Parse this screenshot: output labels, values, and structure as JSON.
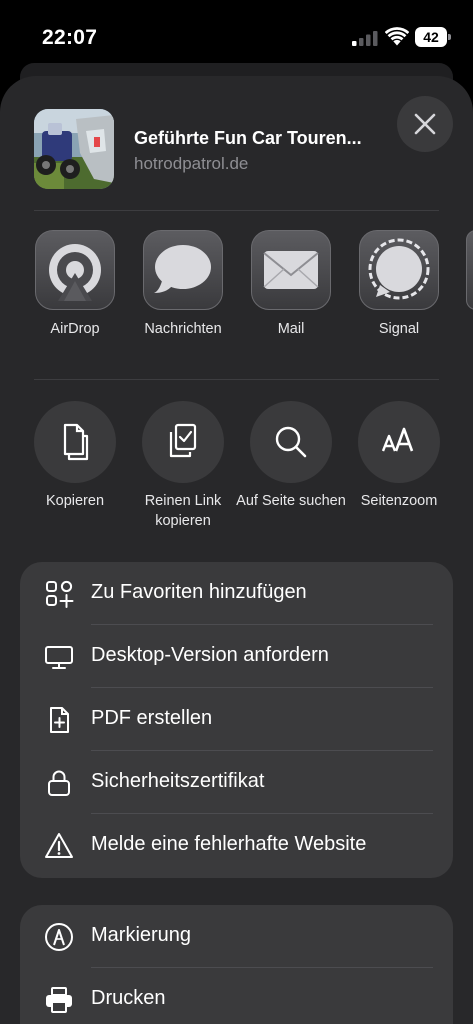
{
  "status_bar": {
    "time": "22:07",
    "battery": "42"
  },
  "share_sheet": {
    "page_title": "Geführte Fun Car Touren...",
    "page_domain": "hotrodpatrol.de",
    "close_icon": "xmark-icon",
    "share_targets": [
      {
        "label": "AirDrop",
        "icon": "airdrop-icon"
      },
      {
        "label": "Nachrichten",
        "icon": "messages-icon"
      },
      {
        "label": "Mail",
        "icon": "mail-icon"
      },
      {
        "label": "Signal",
        "icon": "signal-icon"
      }
    ],
    "actions": [
      {
        "label": "Kopieren",
        "icon": "copy-icon"
      },
      {
        "label": "Reinen Link kopieren",
        "icon": "clean-link-copy-icon"
      },
      {
        "label": "Auf Seite suchen",
        "icon": "search-icon"
      },
      {
        "label": "Seitenzoom",
        "icon": "text-size-icon"
      }
    ],
    "menu_group_1": [
      {
        "label": "Zu Favoriten hinzufügen",
        "icon": "add-favorites-icon"
      },
      {
        "label": "Desktop-Version anfordern",
        "icon": "desktop-icon"
      },
      {
        "label": "PDF erstellen",
        "icon": "pdf-icon"
      },
      {
        "label": "Sicherheitszertifikat",
        "icon": "lock-icon"
      },
      {
        "label": "Melde eine fehlerhafte Website",
        "icon": "warning-icon"
      }
    ],
    "menu_group_2": [
      {
        "label": "Markierung",
        "icon": "markup-icon"
      },
      {
        "label": "Drucken",
        "icon": "print-icon"
      }
    ]
  },
  "colors": {
    "sheet_background": "#28282a",
    "card_background": "#3a3a3c",
    "secondary_text": "#8e8e93"
  }
}
